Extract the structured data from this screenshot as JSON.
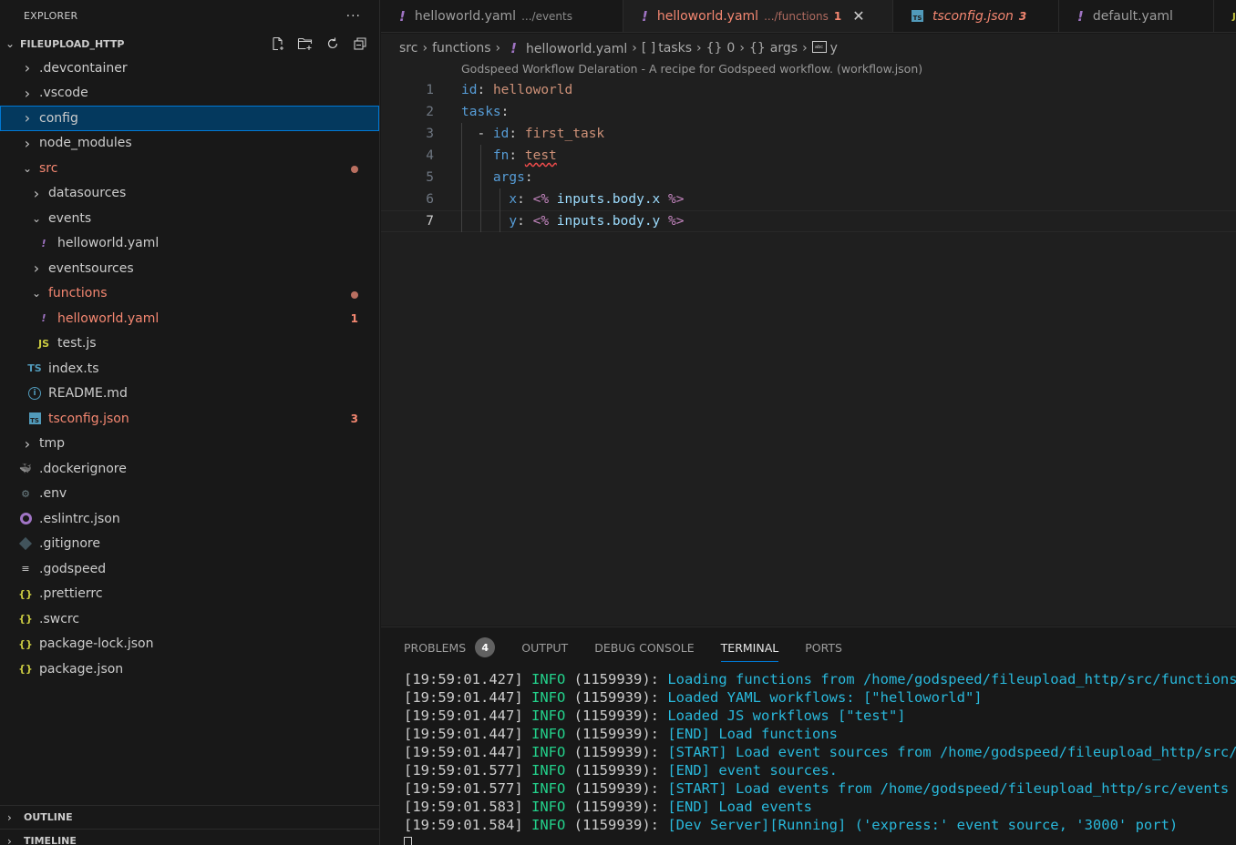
{
  "sidebar": {
    "title": "EXPLORER",
    "more_label": "···",
    "root_label": "FILEUPLOAD_HTTP",
    "actions": [
      {
        "icon": "new-file-icon"
      },
      {
        "icon": "new-folder-icon"
      },
      {
        "icon": "refresh-icon"
      },
      {
        "icon": "collapse-all-icon"
      }
    ],
    "tree": [
      {
        "label": ".devcontainer",
        "type": "folder",
        "expanded": false
      },
      {
        "label": ".vscode",
        "type": "folder",
        "expanded": false
      },
      {
        "label": "config",
        "type": "folder",
        "expanded": false,
        "selected": true
      },
      {
        "label": "node_modules",
        "type": "folder",
        "expanded": false
      },
      {
        "label": "src",
        "type": "folder",
        "expanded": true,
        "error": true
      },
      {
        "label": "datasources",
        "type": "folder",
        "expanded": false
      },
      {
        "label": "events",
        "type": "folder",
        "expanded": true
      },
      {
        "label": "helloworld.yaml",
        "type": "yaml"
      },
      {
        "label": "eventsources",
        "type": "folder",
        "expanded": false
      },
      {
        "label": "functions",
        "type": "folder",
        "expanded": true,
        "error": true
      },
      {
        "label": "helloworld.yaml",
        "type": "yaml",
        "error": true,
        "count": "1"
      },
      {
        "label": "test.js",
        "type": "js",
        "icon_text": "JS"
      },
      {
        "label": "index.ts",
        "type": "ts",
        "icon_text": "TS"
      },
      {
        "label": "README.md",
        "type": "info",
        "icon_text": "i"
      },
      {
        "label": "tsconfig.json",
        "type": "tsconfig",
        "error": true,
        "count": "3",
        "icon_text": "TS"
      },
      {
        "label": "tmp",
        "type": "folder",
        "expanded": false
      },
      {
        "label": ".dockerignore",
        "type": "docker"
      },
      {
        "label": ".env",
        "type": "gear"
      },
      {
        "label": ".eslintrc.json",
        "type": "eslint"
      },
      {
        "label": ".gitignore",
        "type": "git"
      },
      {
        "label": ".godspeed",
        "type": "lines"
      },
      {
        "label": ".prettierrc",
        "type": "braces"
      },
      {
        "label": ".swcrc",
        "type": "braces"
      },
      {
        "label": "package-lock.json",
        "type": "braces"
      },
      {
        "label": "package.json",
        "type": "braces"
      }
    ],
    "outline_label": "OUTLINE",
    "timeline_label": "TIMELINE"
  },
  "tabs": [
    {
      "name": "helloworld.yaml",
      "desc": ".../events",
      "icon": "yaml"
    },
    {
      "name": "helloworld.yaml",
      "desc": ".../functions",
      "count": "1",
      "icon": "yaml",
      "active": true,
      "close": "✕"
    },
    {
      "name": "tsconfig.json",
      "count": "3",
      "icon": "tsconfig"
    },
    {
      "name": "default.yaml",
      "icon": "yaml"
    }
  ],
  "breadcrumb": {
    "items": [
      "src",
      "functions",
      "helloworld.yaml",
      "tasks",
      "0",
      "args",
      "y"
    ]
  },
  "editor": {
    "codelens": "Godspeed Workflow Delaration - A recipe for Godspeed workflow. (workflow.json)",
    "current_line": 7,
    "lines": [
      {
        "n": "1",
        "tokens": [
          [
            "k",
            "id"
          ],
          [
            "p",
            ": "
          ],
          [
            "v",
            "helloworld"
          ]
        ]
      },
      {
        "n": "2",
        "tokens": [
          [
            "k",
            "tasks"
          ],
          [
            "p",
            ":"
          ]
        ]
      },
      {
        "n": "3",
        "tokens": [
          [
            "p",
            "  - "
          ],
          [
            "k",
            "id"
          ],
          [
            "p",
            ": "
          ],
          [
            "v",
            "first_task"
          ]
        ]
      },
      {
        "n": "4",
        "tokens": [
          [
            "p",
            "    "
          ],
          [
            "k",
            "fn"
          ],
          [
            "p",
            ": "
          ],
          [
            "vs",
            "test"
          ]
        ]
      },
      {
        "n": "5",
        "tokens": [
          [
            "p",
            "    "
          ],
          [
            "k",
            "args"
          ],
          [
            "p",
            ":"
          ]
        ]
      },
      {
        "n": "6",
        "tokens": [
          [
            "p",
            "      "
          ],
          [
            "k",
            "x"
          ],
          [
            "p",
            ": "
          ],
          [
            "tpl",
            "<%"
          ],
          [
            "p",
            " "
          ],
          [
            "tv",
            "inputs.body.x"
          ],
          [
            "p",
            " "
          ],
          [
            "tpl",
            "%>"
          ]
        ]
      },
      {
        "n": "7",
        "tokens": [
          [
            "p",
            "      "
          ],
          [
            "k",
            "y"
          ],
          [
            "p",
            ": "
          ],
          [
            "tpl",
            "<%"
          ],
          [
            "p",
            " "
          ],
          [
            "tv",
            "inputs.body.y"
          ],
          [
            "p",
            " "
          ],
          [
            "tpl",
            "%>"
          ]
        ]
      }
    ]
  },
  "panel": {
    "tabs": [
      {
        "label": "PROBLEMS",
        "badge": "4"
      },
      {
        "label": "OUTPUT"
      },
      {
        "label": "DEBUG CONSOLE"
      },
      {
        "label": "TERMINAL",
        "active": true
      },
      {
        "label": "PORTS"
      }
    ],
    "terminal": [
      {
        "ts": "[19:59:01.427]",
        "level": "INFO",
        "pid": "(1159939):",
        "msg": "Loading functions from /home/godspeed/fileupload_http/src/functions"
      },
      {
        "ts": "[19:59:01.447]",
        "level": "INFO",
        "pid": "(1159939):",
        "msg": "Loaded YAML workflows: [\"helloworld\"]"
      },
      {
        "ts": "[19:59:01.447]",
        "level": "INFO",
        "pid": "(1159939):",
        "msg": "Loaded JS workflows [\"test\"]"
      },
      {
        "ts": "[19:59:01.447]",
        "level": "INFO",
        "pid": "(1159939):",
        "msg": "[END] Load functions"
      },
      {
        "ts": "[19:59:01.447]",
        "level": "INFO",
        "pid": "(1159939):",
        "msg": "[START] Load event sources from /home/godspeed/fileupload_http/src/eventsources"
      },
      {
        "ts": "[19:59:01.577]",
        "level": "INFO",
        "pid": "(1159939):",
        "msg": "[END] event sources."
      },
      {
        "ts": "[19:59:01.577]",
        "level": "INFO",
        "pid": "(1159939):",
        "msg": "[START] Load events from /home/godspeed/fileupload_http/src/events"
      },
      {
        "ts": "[19:59:01.583]",
        "level": "INFO",
        "pid": "(1159939):",
        "msg": "[END] Load events"
      },
      {
        "ts": "[19:59:01.584]",
        "level": "INFO",
        "pid": "(1159939):",
        "msg": "[Dev Server][Running] ('express:' event source, '3000' port)"
      }
    ]
  },
  "colors": {
    "accent": "#0078d4",
    "error": "#f48771",
    "selection": "#04395e"
  }
}
